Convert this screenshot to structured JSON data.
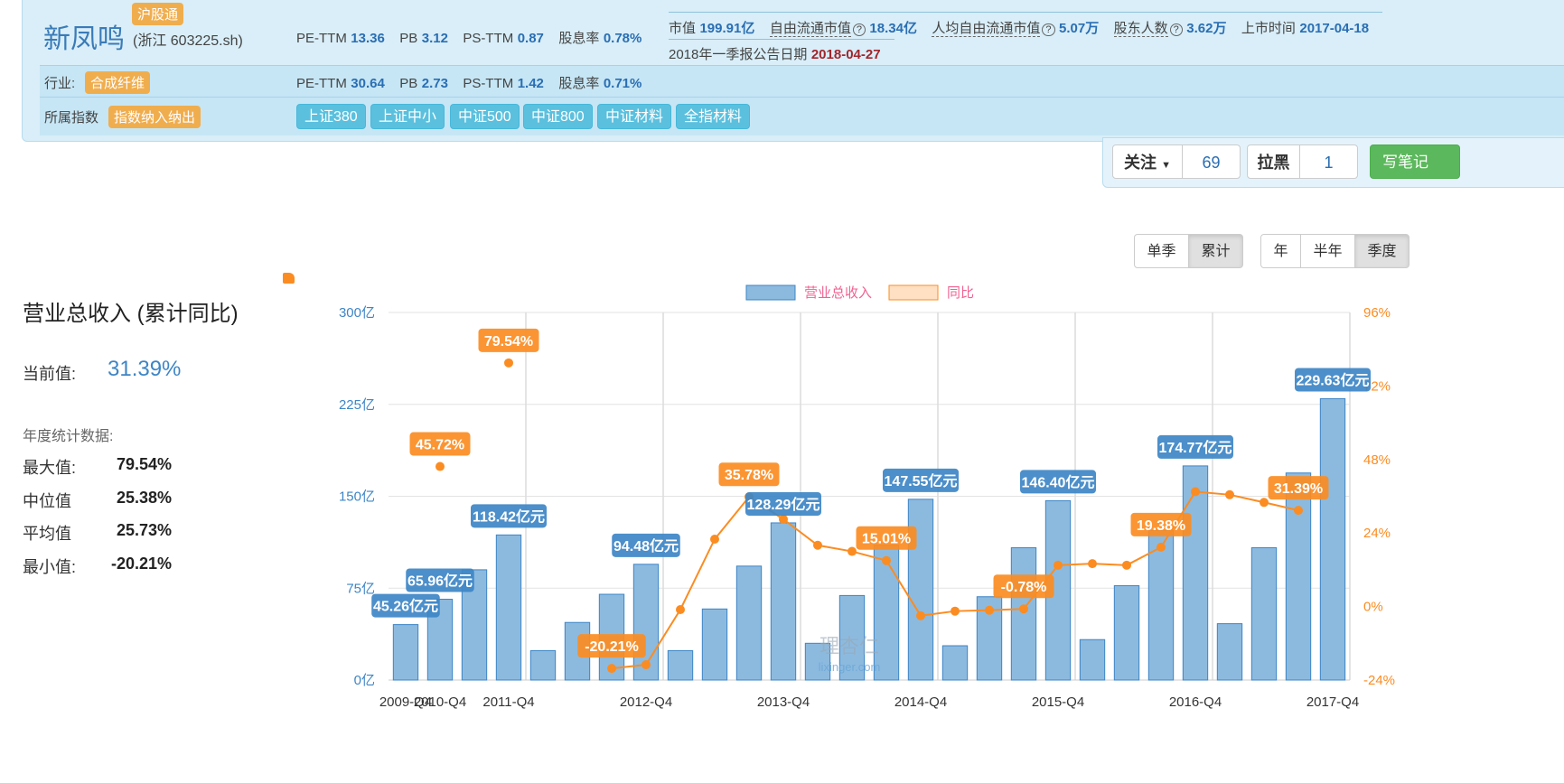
{
  "stock": {
    "name": "新凤鸣",
    "tag": "沪股通",
    "code": "(浙江 603225.sh)"
  },
  "metrics_row1": [
    {
      "label": "PE-TTM",
      "value": "13.36"
    },
    {
      "label": "PB",
      "value": "3.12"
    },
    {
      "label": "PS-TTM",
      "value": "0.87"
    },
    {
      "label": "股息率",
      "value": "0.78%"
    }
  ],
  "market": {
    "cap_label": "市值",
    "cap_value": "199.91亿",
    "free_cap_label": "自由流通市值",
    "free_cap_value": "18.34亿",
    "per_cap_label": "人均自由流通市值",
    "per_cap_value": "5.07万",
    "holders_label": "股东人数",
    "holders_value": "3.62万",
    "listing_label": "上市时间",
    "listing_value": "2017-04-18",
    "report_label": "2018年一季报公告日期",
    "report_value": "2018-04-27",
    "help_glyph": "?"
  },
  "industry": {
    "label": "行业:",
    "tag": "合成纤维",
    "metrics": [
      {
        "label": "PE-TTM",
        "value": "30.64"
      },
      {
        "label": "PB",
        "value": "2.73"
      },
      {
        "label": "PS-TTM",
        "value": "1.42"
      },
      {
        "label": "股息率",
        "value": "0.71%"
      }
    ]
  },
  "indices": {
    "label": "所属指数",
    "tag": "指数纳入纳出",
    "items": [
      "上证380",
      "上证中小",
      "中证500",
      "中证800",
      "中证材料",
      "全指材料"
    ]
  },
  "actions": {
    "follow_label": "关注",
    "follow_count": "69",
    "block_label": "拉黑",
    "block_count": "1",
    "note_label": "写笔记"
  },
  "toggles": {
    "mode": [
      "单季",
      "累计"
    ],
    "mode_selected": "累计",
    "period": [
      "年",
      "半年",
      "季度"
    ],
    "period_selected": "季度"
  },
  "summary": {
    "title": "营业总收入 (累计同比)",
    "current_label": "当前值:",
    "current_value": "31.39%",
    "stats_title": "年度统计数据:",
    "stats": [
      {
        "label": "最大值:",
        "value": "79.54%"
      },
      {
        "label": "中位值",
        "value": "25.38%"
      },
      {
        "label": "平均值",
        "value": "25.73%"
      },
      {
        "label": "最小值:",
        "value": "-20.21%"
      }
    ]
  },
  "watermark": {
    "line1": "理杏仁",
    "line2": "lixinger.com"
  },
  "colors": {
    "bar": "#8cbadf",
    "bar_stroke": "#3d85c6",
    "line": "#fb8c22",
    "label_blue": "#3d85c6",
    "label_orange": "#fb8c22",
    "legend_text": "#f06292"
  },
  "chart_data": {
    "type": "bar+line",
    "legend": [
      "营业总收入",
      "同比"
    ],
    "yaxis_left": {
      "ticks": [
        "0亿",
        "75亿",
        "150亿",
        "225亿",
        "300亿"
      ],
      "range": [
        0,
        300
      ]
    },
    "yaxis_right": {
      "ticks": [
        "-24%",
        "0%",
        "24%",
        "48%",
        "72%",
        "96%"
      ],
      "range": [
        -24,
        96
      ]
    },
    "x_tick_labels": [
      "2009-Q4",
      "2010-Q4",
      "2011-Q4",
      "2012-Q4",
      "2013-Q4",
      "2014-Q4",
      "2015-Q4",
      "2016-Q4",
      "2017-Q4"
    ],
    "categories": [
      "2009-Q4",
      "2010-Q1",
      "2010-Q2",
      "2010-Q3",
      "2010-Q4",
      "2011-Q1",
      "2011-Q2",
      "2011-Q3",
      "2011-Q4",
      "2012-Q1",
      "2012-Q2",
      "2012-Q3",
      "2012-Q4",
      "2013-Q1",
      "2013-Q2",
      "2013-Q3",
      "2013-Q4",
      "2014-Q1",
      "2014-Q2",
      "2014-Q3",
      "2014-Q4",
      "2015-Q1",
      "2015-Q2",
      "2015-Q3",
      "2015-Q4",
      "2016-Q1",
      "2016-Q2",
      "2016-Q3",
      "2016-Q4",
      "2017-Q1",
      "2017-Q2",
      "2017-Q3",
      "2017-Q4"
    ],
    "series": [
      {
        "name": "营业总收入",
        "type": "bar",
        "values": [
          45.26,
          65.96,
          90,
          118.42,
          24,
          47,
          70,
          94.48,
          24,
          58,
          93,
          128.29,
          30,
          69,
          110,
          147.55,
          28,
          68,
          108,
          146.4,
          33,
          77,
          122,
          174.77,
          46,
          108,
          169,
          229.63
        ],
        "labels": {
          "0": "45.26亿元",
          "1": "65.96亿元",
          "3": "118.42亿元",
          "7": "94.48亿元",
          "11": "128.29亿元",
          "15": "147.55亿元",
          "19": "146.40亿元",
          "23": "174.77亿元",
          "27": "229.63亿元"
        }
      },
      {
        "name": "同比",
        "type": "line",
        "values": [
          null,
          45.72,
          null,
          79.54,
          null,
          null,
          -20.21,
          -19,
          -1,
          22,
          35.78,
          28.5,
          20,
          18,
          15.01,
          -3,
          -1.5,
          -1.2,
          -0.78,
          13.5,
          14,
          13.5,
          19.38,
          37.5,
          36.5,
          34,
          31.39
        ],
        "labels": {
          "1": "45.72%",
          "3": "79.54%",
          "6": "-20.21%",
          "10": "35.78%",
          "14": "15.01%",
          "18": "-0.78%",
          "22": "19.38%",
          "26": "31.39%"
        }
      }
    ]
  }
}
